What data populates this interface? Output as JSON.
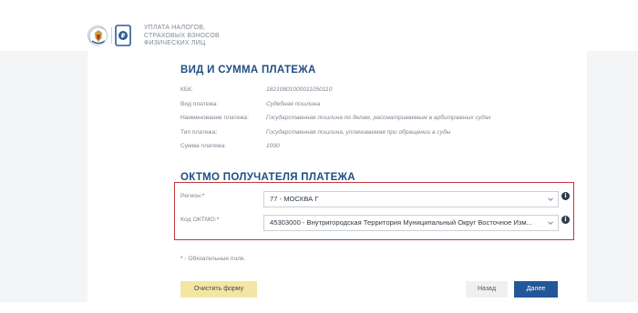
{
  "header": {
    "title_lines": [
      "УПЛАТА НАЛОГОВ,",
      "СТРАХОВЫХ ВЗНОСОВ",
      "ФИЗИЧЕСКИХ ЛИЦ"
    ],
    "emblem_icon": "fns-emblem-icon",
    "document_icon": "ruble-document-icon"
  },
  "payment": {
    "title": "ВИД И СУММА ПЛАТЕЖА",
    "rows": [
      {
        "label": "КБК:",
        "value": "18210801000011050110"
      },
      {
        "label": "Вид платежа:",
        "value": "Судебная пошлина"
      },
      {
        "label": "Наименование платежа:",
        "value": "Государственная пошлина по делам, рассматриваемым в арбитражных судах"
      },
      {
        "label": "Тип платежа:",
        "value": "Государственная пошлина, уплачиваемая при обращении в суды"
      },
      {
        "label": "Сумма платежа:",
        "value": "1000"
      }
    ]
  },
  "oktmo": {
    "title": "ОКТМО ПОЛУЧАТЕЛЯ ПЛАТЕЖА",
    "region": {
      "label": "Регион:",
      "required_mark": "*",
      "value": "77 - МОСКВА Г"
    },
    "code": {
      "label": "Код ОКТМО:",
      "required_mark": "*",
      "value": "45303000 - Внутригородская Территория Муниципальный Округ Восточное Изм..."
    },
    "info_glyph": "i",
    "highlight_color": "#c4363b"
  },
  "required_note": {
    "mark": "*",
    "text": " - Обязательные поля."
  },
  "buttons": {
    "clear": "Очистить форму",
    "back": "Назад",
    "next": "Далее"
  },
  "colors": {
    "accent": "#24579a",
    "title": "#1f4f82",
    "clear_button": "#f3e6a4",
    "required": "#d9383d"
  }
}
